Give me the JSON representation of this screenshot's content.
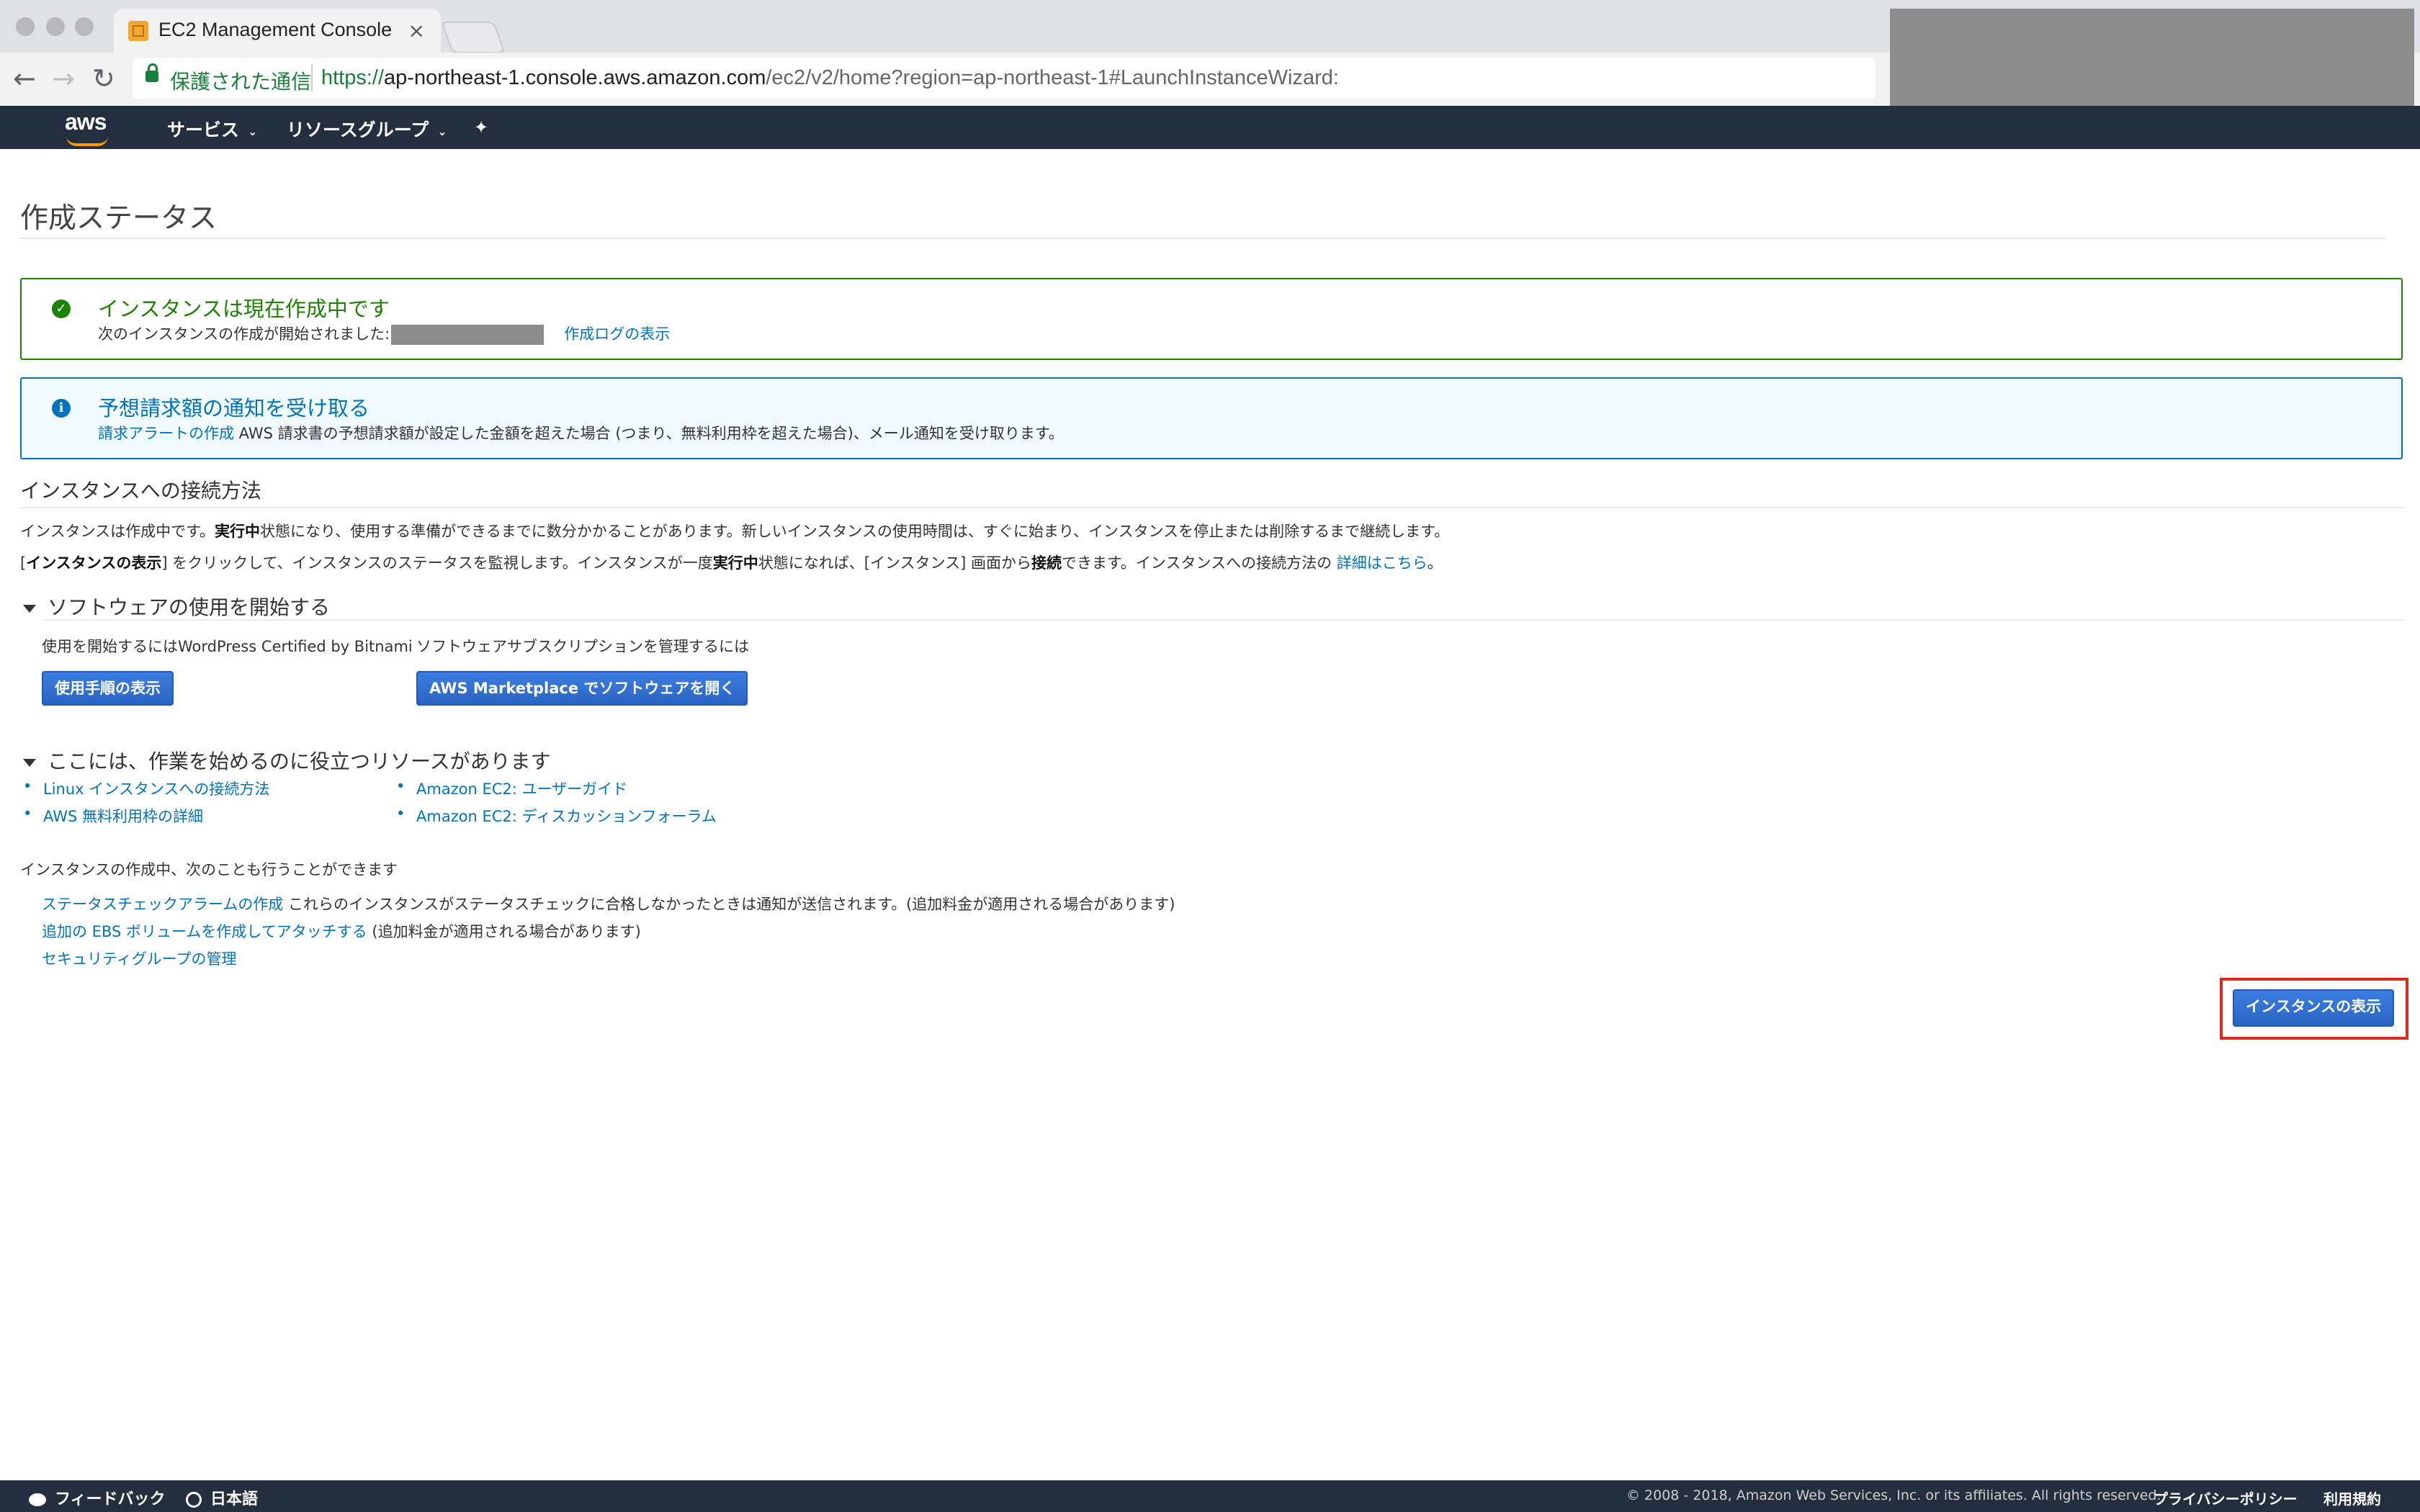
{
  "browser": {
    "tab_title": "EC2 Management Console",
    "tab_close": "×",
    "secure_label": "保護された通信",
    "url_scheme": "https://",
    "url_host": "ap-northeast-1.console.aws.amazon.com",
    "url_path": "/ec2/v2/home?region=ap-northeast-1#LaunchInstanceWizard:",
    "back": "←",
    "forward": "→",
    "reload": "↻"
  },
  "aws_nav": {
    "logo": "aws",
    "services": "サービス",
    "resource_groups": "リソースグループ",
    "chevron": "⌄",
    "pin": "✦"
  },
  "page": {
    "title": "作成ステータス",
    "success_alert": {
      "icon": "✓",
      "title": "インスタンスは現在作成中です",
      "body_prefix": "次のインスタンスの作成が開始されました:",
      "log_link": "作成ログの表示"
    },
    "info_alert": {
      "icon": "i",
      "title": "予想請求額の通知を受け取る",
      "link": "請求アラートの作成",
      "body": " AWS 請求書の予想請求額が設定した金額を超えた場合 (つまり、無料利用枠を超えた場合)、メール通知を受け取ります。"
    },
    "connect": {
      "heading": "インスタンスへの接続方法",
      "p1_a": "インスタンスは作成中です。",
      "p1_b": "実行中",
      "p1_c": "状態になり、使用する準備ができるまでに数分かかることがあります。新しいインスタンスの使用時間は、すぐに始まり、インスタンスを停止または削除するまで継続します。",
      "p2_a": "[",
      "p2_b": "インスタンスの表示",
      "p2_c": "] をクリックして、インスタンスのステータスを監視します。インスタンスが一度",
      "p2_d": "実行中",
      "p2_e": "状態になれば、[インスタンス] 画面から",
      "p2_f": "接続",
      "p2_g": "できます。インスタンスへの接続方法の ",
      "p2_link": "詳細はこちら",
      "p2_end": "。"
    },
    "software": {
      "heading": "ソフトウェアの使用を開始する",
      "label_left": "使用を開始するにはWordPress Certified by Bitnami",
      "label_right": "ソフトウェアサブスクリプションを管理するには",
      "btn_left": "使用手順の表示",
      "btn_right": "AWS Marketplace でソフトウェアを開く"
    },
    "resources": {
      "heading": "ここには、作業を始めるのに役立つリソースがあります",
      "bullet": "•",
      "left": [
        "Linux インスタンスへの接続方法",
        "AWS 無料利用枠の詳細"
      ],
      "right": [
        "Amazon EC2: ユーザーガイド",
        "Amazon EC2: ディスカッションフォーラム"
      ]
    },
    "also": {
      "heading": "インスタンスの作成中、次のことも行うことができます",
      "line1_link": "ステータスチェックアラームの作成",
      "line1_text": " これらのインスタンスがステータスチェックに合格しなかったときは通知が送信されます。(追加料金が適用される場合があります)",
      "line2_link": "追加の EBS ボリュームを作成してアタッチする",
      "line2_text": " (追加料金が適用される場合があります)",
      "line3_link": "セキュリティグループの管理"
    },
    "view_instances_button": "インスタンスの表示"
  },
  "footer": {
    "feedback": "フィードバック",
    "language": "日本語",
    "copyright": "© 2008 - 2018, Amazon Web Services, Inc. or its affiliates. All rights reserved.",
    "privacy": "プライバシーポリシー",
    "terms": "利用規約"
  },
  "colors": {
    "nav_bg": "#232f3e",
    "success": "#1d8102",
    "info": "#0073bb",
    "primary_button": "#2f6fd0",
    "highlight_frame": "#e0281e"
  }
}
